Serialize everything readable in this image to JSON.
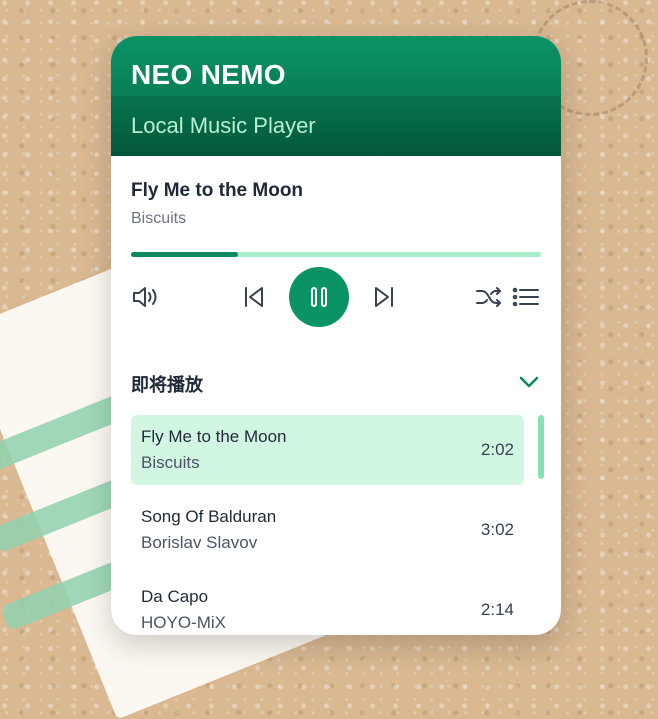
{
  "app": {
    "brand": "NEO NEMO",
    "subtitle": "Local Music Player"
  },
  "now_playing": {
    "title": "Fly Me to the Moon",
    "artist": "Biscuits",
    "progress": 0.26
  },
  "controls": {
    "volume_icon": "volume-icon",
    "prev_icon": "skip-previous-icon",
    "play_icon": "pause-icon",
    "next_icon": "skip-next-icon",
    "shuffle_icon": "shuffle-icon",
    "list_icon": "playlist-icon"
  },
  "queue": {
    "title": "即将播放",
    "items": [
      {
        "name": "Fly Me to the Moon",
        "artist": "Biscuits",
        "duration": "2:02",
        "active": true
      },
      {
        "name": "Song Of Balduran",
        "artist": "Borislav Slavov",
        "duration": "3:02",
        "active": false
      },
      {
        "name": "Da Capo",
        "artist": "HOYO-MiX",
        "duration": "2:14",
        "active": false
      }
    ]
  },
  "colors": {
    "accent": "#0b9463",
    "progress_track": "#a8ecc9",
    "active_item": "#d1f7e3"
  }
}
